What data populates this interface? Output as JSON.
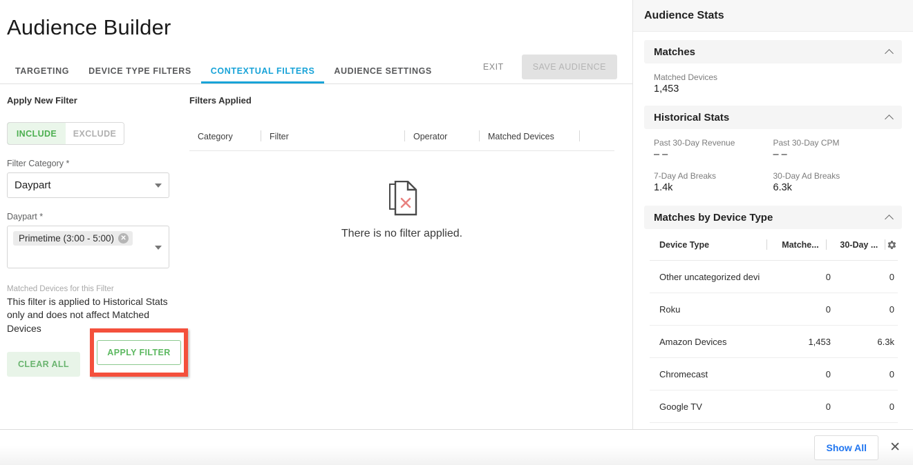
{
  "header": {
    "title": "Audience Builder"
  },
  "tabs": [
    {
      "label": "TARGETING",
      "active": false
    },
    {
      "label": "DEVICE TYPE FILTERS",
      "active": false
    },
    {
      "label": "CONTEXTUAL FILTERS",
      "active": true
    },
    {
      "label": "AUDIENCE SETTINGS",
      "active": false
    }
  ],
  "actions": {
    "exit_label": "EXIT",
    "save_label": "SAVE AUDIENCE"
  },
  "filter_pane": {
    "heading": "Apply New Filter",
    "include_label": "INCLUDE",
    "exclude_label": "EXCLUDE",
    "include_active": true,
    "category_label": "Filter Category *",
    "category_value": "Daypart",
    "daypart_label": "Daypart *",
    "daypart_chip": "Primetime (3:00 - 5:00)",
    "matched_label": "Matched Devices for this Filter",
    "matched_note": "This filter is applied to Historical Stats only and does not affect Matched Devices",
    "clear_all_label": "CLEAR ALL",
    "apply_filter_label": "APPLY FILTER",
    "highlight_color": "#f4503c"
  },
  "filters_applied": {
    "heading": "Filters Applied",
    "columns": [
      "Category",
      "Filter",
      "Operator",
      "Matched Devices"
    ],
    "empty_message": "There is no filter applied.",
    "rows": []
  },
  "sidebar": {
    "title": "Audience Stats",
    "matches": {
      "section_label": "Matches",
      "stat_label": "Matched Devices",
      "stat_value": "1,453"
    },
    "historical": {
      "section_label": "Historical Stats",
      "items": [
        {
          "label": "Past 30-Day Revenue",
          "value": "– –"
        },
        {
          "label": "Past 30-Day CPM",
          "value": "– –"
        },
        {
          "label": "7-Day Ad Breaks",
          "value": "1.4k"
        },
        {
          "label": "30-Day Ad Breaks",
          "value": "6.3k"
        }
      ]
    },
    "device_types": {
      "section_label": "Matches by Device Type",
      "columns": [
        "Device Type",
        "Matche...",
        "30-Day ..."
      ],
      "settings_icon": "gear-icon",
      "rows": [
        {
          "device": "Other uncategorized devi",
          "matched": "0",
          "thirty_day": "0"
        },
        {
          "device": "Roku",
          "matched": "0",
          "thirty_day": "0"
        },
        {
          "device": "Amazon Devices",
          "matched": "1,453",
          "thirty_day": "6.3k"
        },
        {
          "device": "Chromecast",
          "matched": "0",
          "thirty_day": "0"
        },
        {
          "device": "Google TV",
          "matched": "0",
          "thirty_day": "0"
        }
      ]
    }
  },
  "bottom_bar": {
    "show_all_label": "Show All",
    "close_label": "✕"
  }
}
